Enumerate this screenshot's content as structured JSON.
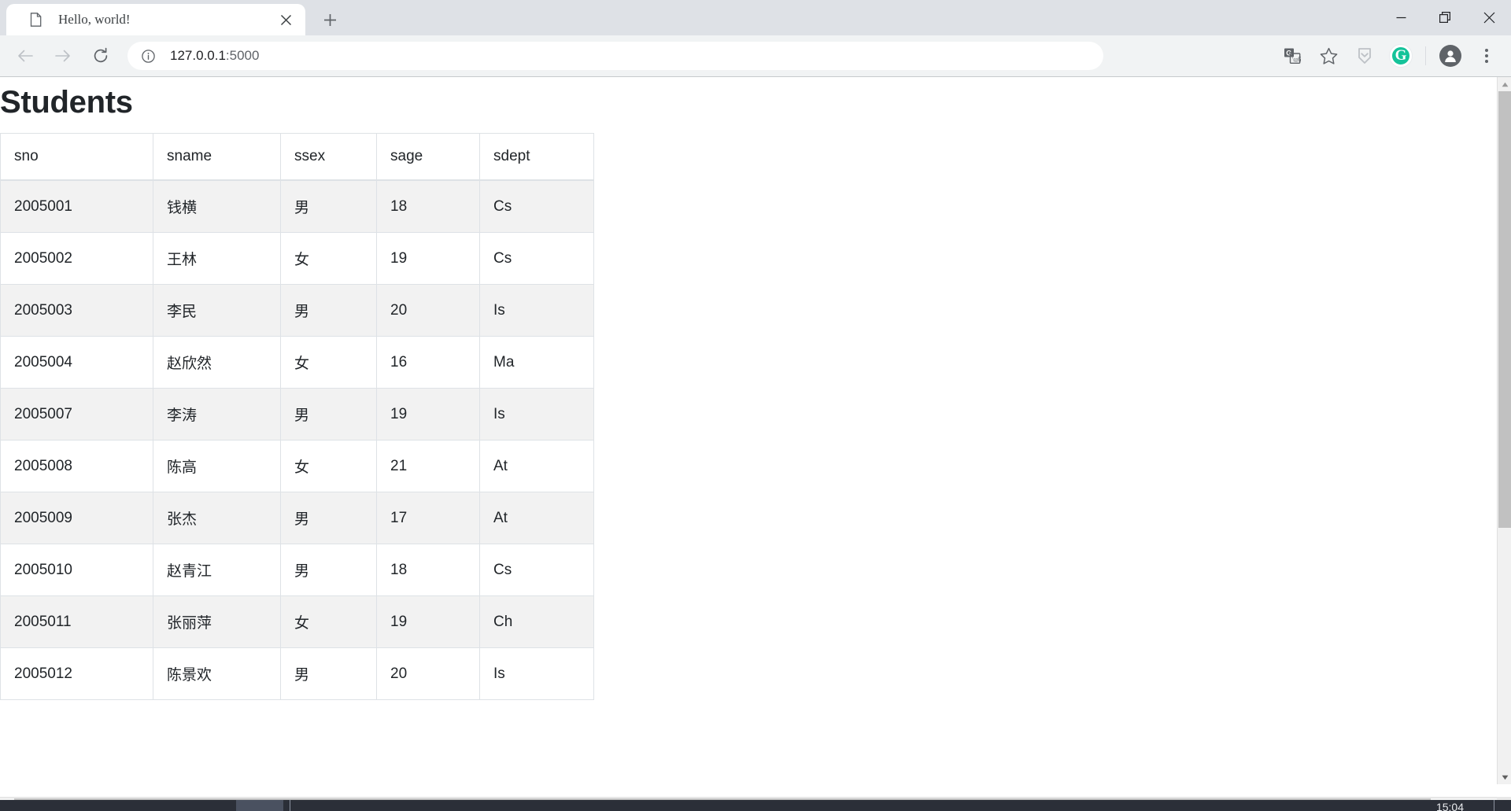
{
  "browser": {
    "tab": {
      "title": "Hello, world!",
      "favicon": "page-document-icon",
      "close_label": "✕"
    },
    "new_tab_label": "+",
    "window_controls": {
      "minimize": "—",
      "restore": "restore-icon",
      "close": "✕"
    },
    "toolbar": {
      "back": "back-arrow-icon",
      "forward": "forward-arrow-icon",
      "reload": "reload-icon",
      "site_info": "info-circle-icon",
      "url_host": "127.0.0.1",
      "url_port": ":5000",
      "url_full": "127.0.0.1:5000",
      "icons": [
        {
          "name": "translate-icon",
          "glyph": "translate"
        },
        {
          "name": "bookmark-star-icon",
          "glyph": "☆"
        },
        {
          "name": "pocket-extension-icon",
          "glyph": "shield"
        },
        {
          "name": "grammarly-extension-icon",
          "glyph": "G"
        },
        {
          "name": "profile-avatar-icon",
          "glyph": "person"
        },
        {
          "name": "chrome-menu-icon",
          "glyph": "⋮"
        }
      ]
    }
  },
  "page": {
    "heading": "Students",
    "table": {
      "columns": [
        "sno",
        "sname",
        "ssex",
        "sage",
        "sdept"
      ],
      "rows": [
        [
          "2005001",
          "钱横",
          "男",
          "18",
          "Cs"
        ],
        [
          "2005002",
          "王林",
          "女",
          "19",
          "Cs"
        ],
        [
          "2005003",
          "李民",
          "男",
          "20",
          "Is"
        ],
        [
          "2005004",
          "赵欣然",
          "女",
          "16",
          "Ma"
        ],
        [
          "2005007",
          "李涛",
          "男",
          "19",
          "Is"
        ],
        [
          "2005008",
          "陈高",
          "女",
          "21",
          "At"
        ],
        [
          "2005009",
          "张杰",
          "男",
          "17",
          "At"
        ],
        [
          "2005010",
          "赵青江",
          "男",
          "18",
          "Cs"
        ],
        [
          "2005011",
          "张丽萍",
          "女",
          "19",
          "Ch"
        ],
        [
          "2005012",
          "陈景欢",
          "男",
          "20",
          "Is"
        ]
      ]
    }
  },
  "scrollbars": {
    "vertical_up": "▲",
    "vertical_down": "▼",
    "horizontal_left": "◀",
    "horizontal_right": "▶"
  },
  "taskbar": {
    "clock": "15:04"
  },
  "colors": {
    "tabstrip_bg": "#dee1e6",
    "toolbar_bg": "#f1f3f4",
    "table_border": "#dee2e6",
    "table_stripe": "#f2f2f2",
    "text": "#212529",
    "grammarly_green": "#15c39a",
    "scrollbar_thumb": "#c1c1c1"
  }
}
